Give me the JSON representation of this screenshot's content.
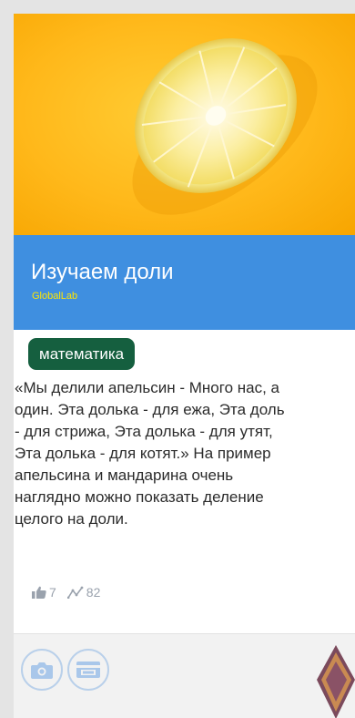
{
  "card": {
    "image": {
      "subject": "lemon-slice"
    },
    "title": "Изучаем доли",
    "author": "GlobalLab",
    "tag": "математика",
    "description_lines": [
      "«Мы делили апельсин - Много нас, а",
      "один. Эта долька - для ежа, Эта доль",
      "- для стрижа, Эта долька - для утят,",
      "Эта долька - для котят.» На пример",
      "апельсина и мандарина очень",
      "наглядно можно показать деление",
      "целого на доли."
    ],
    "stats": {
      "likes": "7",
      "views": "82"
    },
    "footer": {
      "buttons": [
        "camera-icon",
        "card-icon"
      ]
    }
  },
  "colors": {
    "title_bar": "#3f8fe0",
    "author": "#ffe600",
    "tag_bg": "#155f3f",
    "hero_bg": "#ffb81a"
  }
}
